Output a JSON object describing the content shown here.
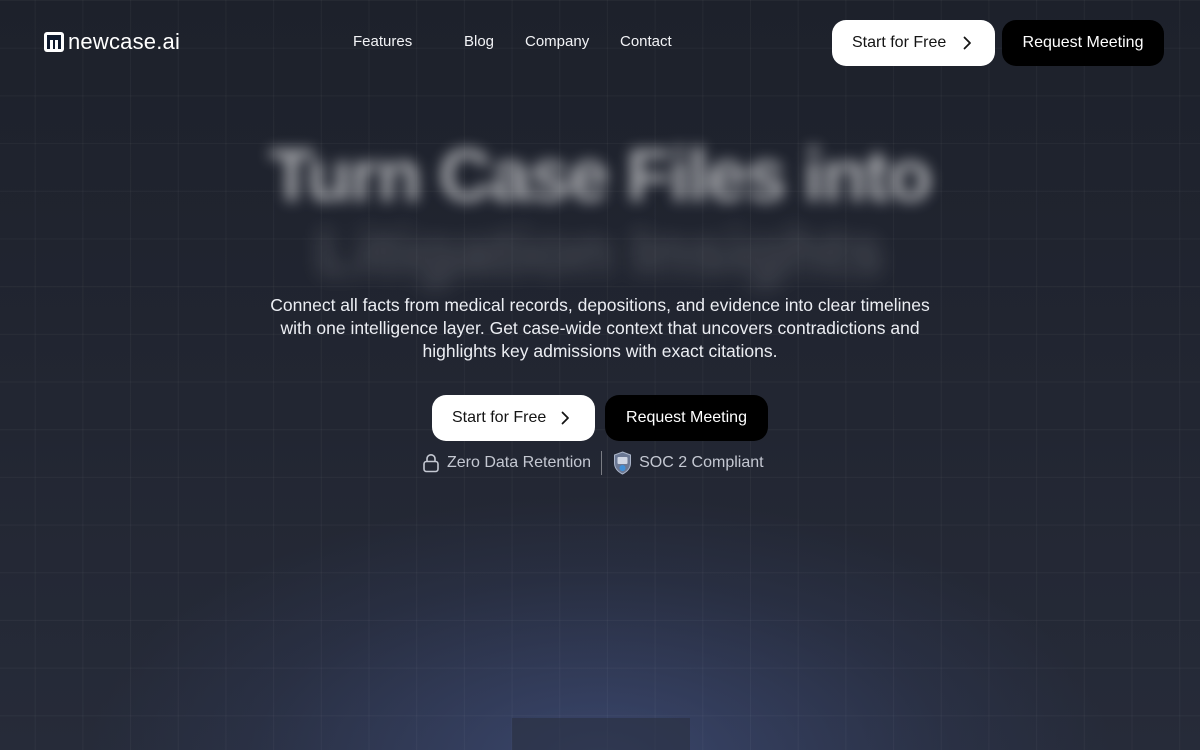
{
  "brand": {
    "name": "newcase.ai"
  },
  "nav": {
    "items": [
      {
        "label": "Features"
      },
      {
        "label": "Blog"
      },
      {
        "label": "Company"
      },
      {
        "label": "Contact"
      }
    ],
    "cta_primary": "Start for Free",
    "cta_secondary": "Request Meeting"
  },
  "hero": {
    "title_line1": "Turn Case Files into",
    "title_line2": "Litigation Insights",
    "subtitle": "Connect all facts from medical records, depositions, and evidence into clear timelines with one intelligence layer. Get case-wide context that uncovers contradictions and highlights key admissions with exact citations.",
    "cta_primary": "Start for Free",
    "cta_secondary": "Request Meeting"
  },
  "trust_badges": [
    {
      "label": "Zero Data Retention",
      "icon": "lock-icon"
    },
    {
      "label": "SOC 2 Compliant",
      "icon": "soc2-shield-icon"
    }
  ],
  "colors": {
    "background": "#1e222c",
    "glow": "#4a5c96",
    "button_primary_bg": "#ffffff",
    "button_secondary_bg": "#000000"
  }
}
